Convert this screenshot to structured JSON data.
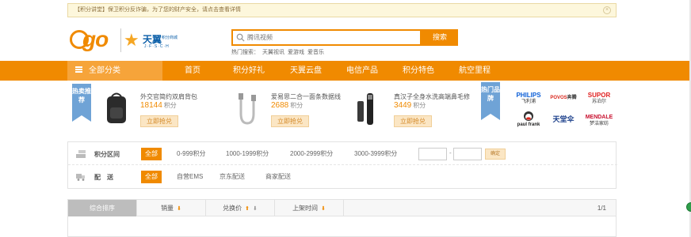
{
  "notice": {
    "text": "【积分讲堂】保卫积分反诈骗，为了您的财产安全，请点击查看详情",
    "close_glyph": "×"
  },
  "logo": {
    "go_text": "go",
    "tianyi_name": "天翼",
    "tianyi_sub": "积分商城",
    "tianyi_en": "J·F·S·C·H"
  },
  "search": {
    "placeholder": "腾讯视频",
    "button_label": "搜索",
    "hot_label": "热门搜索：",
    "hot_terms": [
      "天翼视讯",
      "爱游戏",
      "爱音乐"
    ]
  },
  "nav": {
    "category_label": "全部分类",
    "items": [
      "首页",
      "积分好礼",
      "天翼云盘",
      "电信产品",
      "积分特色",
      "航空里程"
    ]
  },
  "featured": {
    "badge_left": "热卖推荐",
    "badge_right": "热门品牌",
    "unit": "积分",
    "button_label": "立即抢兑",
    "products": [
      {
        "title": "外交官简约双肩背包",
        "price": "18144"
      },
      {
        "title": "爱易思二合一面条数据线",
        "price": "2688"
      },
      {
        "title": "真汉子全身水洗高端鼻毛修",
        "price": "3449"
      }
    ],
    "brands": [
      {
        "name": "PHILIPS",
        "sub": "飞利浦",
        "color": "#0b5ed7"
      },
      {
        "name": "POVOS",
        "sub": "奔腾",
        "color": "#d9261c"
      },
      {
        "name": "SUPOR",
        "sub": "苏泊尔",
        "color": "#e02020"
      },
      {
        "name": "paul frank",
        "sub": "",
        "color": "#222222"
      },
      {
        "name": "天堂伞",
        "sub": "",
        "color": "#1a3e8a"
      },
      {
        "name": "MENDALE",
        "sub": "梦洁家纺",
        "color": "#c8102e"
      }
    ]
  },
  "filter": {
    "range_label": "积分区间",
    "range_options": [
      "全部",
      "0-999积分",
      "1000-1999积分",
      "2000-2999积分",
      "3000-3999积分"
    ],
    "range_dash": "-",
    "range_confirm": "确定",
    "delivery_label": "配　送",
    "delivery_options": [
      "全部",
      "自营EMS",
      "京东配送",
      "商家配送"
    ]
  },
  "sort": {
    "tabs": [
      "综合排序",
      "销量",
      "兑换价",
      "上架时间"
    ],
    "pager": "1/1"
  },
  "colors": {
    "accent": "#f08a00",
    "nav_category": "#f6a43a",
    "badge_blue": "#6fa3d6"
  }
}
